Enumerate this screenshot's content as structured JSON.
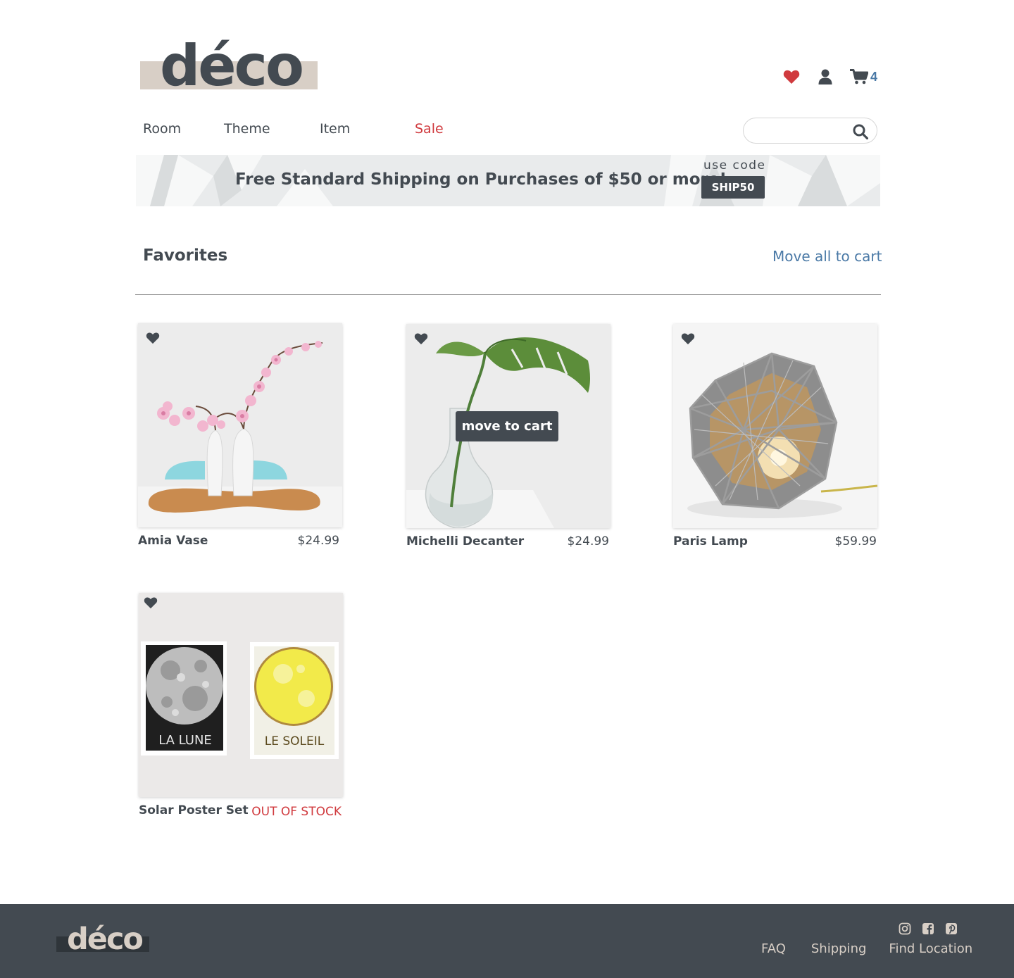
{
  "header": {
    "logo_text": "déco",
    "cart_count": "4",
    "icons": [
      "heart-icon",
      "user-icon",
      "cart-icon"
    ]
  },
  "nav": {
    "items": [
      "Room",
      "Theme",
      "Item",
      "Sale"
    ]
  },
  "search": {
    "placeholder": "",
    "value": ""
  },
  "banner": {
    "message": "Free Standard Shipping on Purchases of $50 or more!",
    "use_code_label": "use code",
    "code": "SHIP50"
  },
  "favorites": {
    "title": "Favorites",
    "move_all_label": "Move all to cart",
    "move_to_cart_label": "move to cart",
    "products": [
      {
        "name": "Amia Vase",
        "price": "$24.99"
      },
      {
        "name": "Michelli Decanter",
        "price": "$24.99"
      },
      {
        "name": "Paris Lamp",
        "price": "$59.99"
      },
      {
        "name": "Solar Poster Set",
        "price": "OUT OF STOCK"
      }
    ],
    "poster_labels": [
      "LA LUNE",
      "LE SOLEIL"
    ]
  },
  "footer": {
    "logo_text": "déco",
    "social": [
      "instagram-icon",
      "facebook-icon",
      "pinterest-icon"
    ],
    "links": [
      "FAQ",
      "Shipping",
      "Find Location"
    ]
  },
  "colors": {
    "dark": "#434a51",
    "accent_red": "#d03a3e",
    "accent_blue": "#4a79a6",
    "logo_band": "#d8cfc6"
  }
}
